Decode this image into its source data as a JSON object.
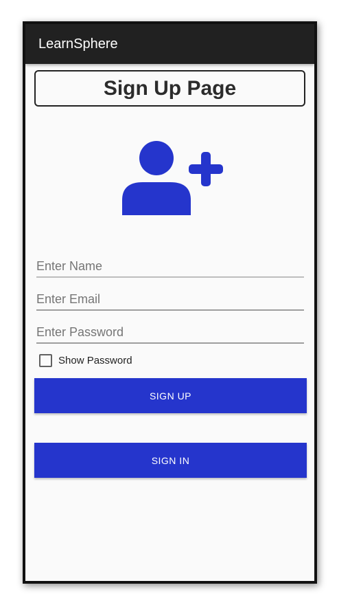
{
  "app": {
    "title": "LearnSphere"
  },
  "page": {
    "heading": "Sign Up Page"
  },
  "form": {
    "name_placeholder": "Enter Name",
    "name_value": "",
    "email_placeholder": "Enter Email",
    "email_value": "",
    "password_placeholder": "Enter Password",
    "password_value": "",
    "show_password_label": "Show Password",
    "show_password_checked": false
  },
  "buttons": {
    "sign_up_label": "SIGN UP",
    "sign_in_label": "SIGN IN"
  },
  "icons": {
    "avatar": "add-user-icon"
  },
  "colors": {
    "accent": "#2535cc",
    "appbar": "#212121",
    "background": "#fafafa"
  }
}
